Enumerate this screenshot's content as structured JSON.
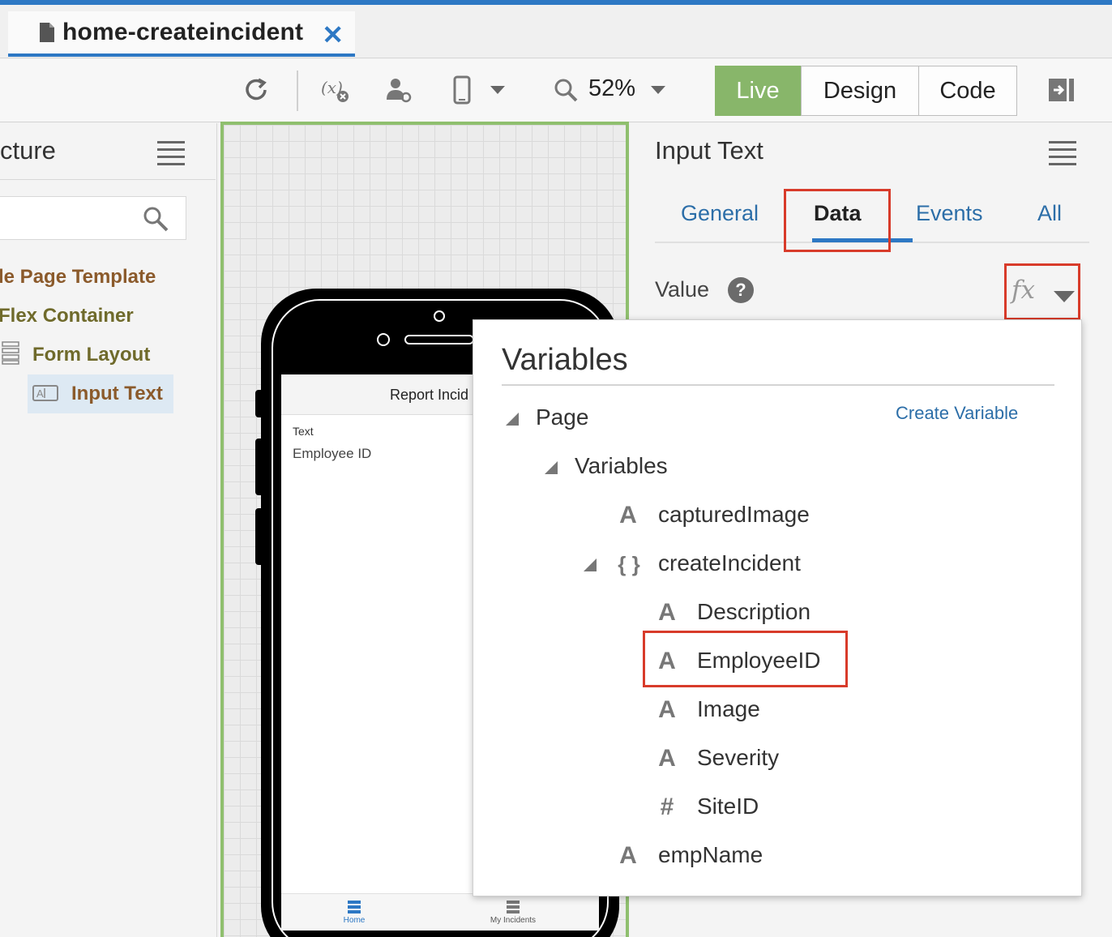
{
  "tab": {
    "title": "home-createincident",
    "close": "✕"
  },
  "toolbar": {
    "zoom": "52%",
    "modes": {
      "live": "Live",
      "design": "Design",
      "code": "Code"
    }
  },
  "structure": {
    "title": "cture",
    "items": [
      {
        "label": "le Page Template"
      },
      {
        "label": "Flex Container"
      },
      {
        "label": "Form Layout"
      },
      {
        "label": "Input Text"
      }
    ]
  },
  "preview": {
    "page_title": "Report Incid",
    "field_label": "Text",
    "field_value": "Employee ID",
    "nav": [
      {
        "label": "Home"
      },
      {
        "label": "My Incidents"
      }
    ]
  },
  "properties": {
    "title": "Input Text",
    "tabs": [
      {
        "label": "General"
      },
      {
        "label": "Data"
      },
      {
        "label": "Events"
      },
      {
        "label": "All"
      }
    ],
    "value_label": "Value",
    "help": "?",
    "fx": "fx"
  },
  "variables_popup": {
    "title": "Variables",
    "create_variable": "Create Variable",
    "page": "Page",
    "variables": "Variables",
    "items": {
      "capturedImage": "capturedImage",
      "createIncident": "createIncident",
      "description": "Description",
      "employeeID": "EmployeeID",
      "image": "Image",
      "severity": "Severity",
      "siteID": "SiteID",
      "empName": "empName"
    },
    "type_string": "A",
    "type_object": "{ }",
    "type_number": "#"
  },
  "colors": {
    "accent": "#2d78c4",
    "live": "#88b66a",
    "highlight": "#d83b2a",
    "tree_brown": "#8b5a2b"
  }
}
